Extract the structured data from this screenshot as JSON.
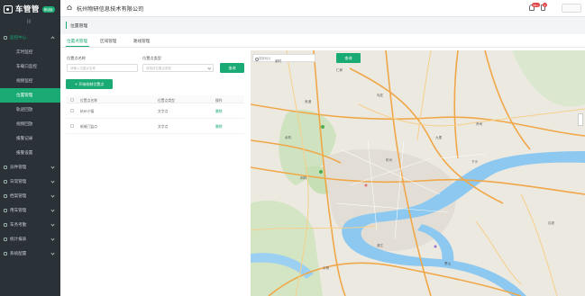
{
  "app": {
    "name": "车管管",
    "badge": "移动版"
  },
  "sidebar": {
    "collapse_label": "|||",
    "items": [
      {
        "label": "监控中心",
        "type": "main",
        "open": true
      },
      {
        "label": "实时监控",
        "type": "sub"
      },
      {
        "label": "车载口监控",
        "type": "sub"
      },
      {
        "label": "视频监控",
        "type": "sub"
      },
      {
        "label": "位置管理",
        "type": "sub",
        "active": true
      },
      {
        "label": "轨迹回放",
        "type": "sub"
      },
      {
        "label": "视频回放",
        "type": "sub"
      },
      {
        "label": "报警记录",
        "type": "sub"
      },
      {
        "label": "报警设置",
        "type": "sub"
      },
      {
        "label": "派件管理",
        "type": "group"
      },
      {
        "label": "日常管理",
        "type": "group"
      },
      {
        "label": "档案管理",
        "type": "group"
      },
      {
        "label": "用车管理",
        "type": "group"
      },
      {
        "label": "车务考勤",
        "type": "group"
      },
      {
        "label": "统计报表",
        "type": "group"
      },
      {
        "label": "系统配置",
        "type": "group"
      }
    ]
  },
  "header": {
    "company": "杭州物研信息技术有限公司",
    "bell_badge": "99+",
    "doc_badge": "2"
  },
  "breadcrumb": {
    "title": "位置管理"
  },
  "tabs": [
    "位置点管理",
    "区域管理",
    "路线管理"
  ],
  "filters": {
    "name_label": "位置点名称",
    "name_placeholder": "请输入位置点名称",
    "type_label": "位置点类型",
    "type_placeholder": "请选择位置点类型",
    "search_button": "查询",
    "add_button": "+ 开始绘制位置点"
  },
  "table": {
    "columns": [
      "位置点名称",
      "位置点类型",
      "操作"
    ],
    "rows": [
      {
        "name": "杭州小镇",
        "type": "文字点",
        "action": "删除"
      },
      {
        "name": "新城门监点",
        "type": "文字点",
        "action": "删除"
      }
    ]
  },
  "map": {
    "search_placeholder": "搜索地点",
    "search_button": "查询",
    "labels": [
      "谢村",
      "仁和",
      "良渚",
      "勾庄",
      "余杭",
      "闲林",
      "九堡",
      "乔司",
      "下沙",
      "杭州",
      "滨江",
      "萧山",
      "瓜沥",
      "义桥"
    ]
  },
  "colors": {
    "accent": "#1aaa73",
    "sidebar": "#2a3137",
    "river": "#8cc8f0",
    "highway": "#f0a748"
  }
}
